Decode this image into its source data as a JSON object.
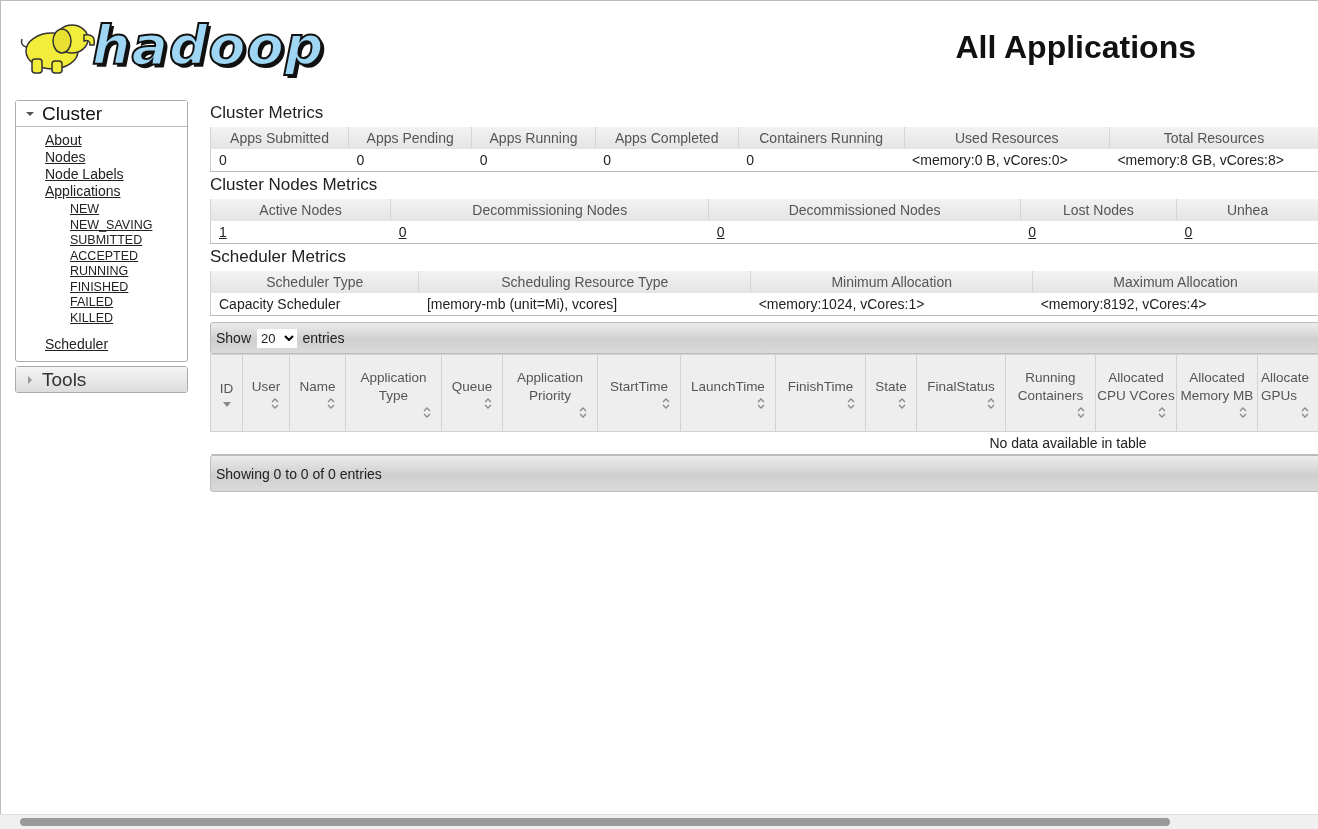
{
  "logo": {
    "text": "hadoop"
  },
  "title": "All Applications",
  "sidebar": [
    {
      "label": "Cluster",
      "expanded": true,
      "items": [
        {
          "label": "About"
        },
        {
          "label": "Nodes"
        },
        {
          "label": "Node Labels"
        },
        {
          "label": "Applications",
          "children": [
            {
              "label": "NEW"
            },
            {
              "label": "NEW_SAVING"
            },
            {
              "label": "SUBMITTED"
            },
            {
              "label": "ACCEPTED"
            },
            {
              "label": "RUNNING"
            },
            {
              "label": "FINISHED"
            },
            {
              "label": "FAILED"
            },
            {
              "label": "KILLED"
            }
          ]
        },
        {
          "label": "Scheduler"
        }
      ]
    },
    {
      "label": "Tools",
      "expanded": false
    }
  ],
  "metrics": [
    {
      "title": "Cluster Metrics",
      "columns": [
        "Apps Submitted",
        "Apps Pending",
        "Apps Running",
        "Apps Completed",
        "Containers Running",
        "Used Resources",
        "Total Resources"
      ],
      "cells": [
        {
          "text": "0",
          "link": false
        },
        {
          "text": "0",
          "link": false
        },
        {
          "text": "0",
          "link": false
        },
        {
          "text": "0",
          "link": false
        },
        {
          "text": "0",
          "link": false
        },
        {
          "text": "<memory:0 B, vCores:0>",
          "link": false
        },
        {
          "text": "<memory:8 GB, vCores:8>",
          "link": false
        }
      ]
    },
    {
      "title": "Cluster Nodes Metrics",
      "columns": [
        "Active Nodes",
        "Decommissioning Nodes",
        "Decommissioned Nodes",
        "Lost Nodes",
        "Unhea"
      ],
      "cells": [
        {
          "text": "1",
          "link": true
        },
        {
          "text": "0",
          "link": true
        },
        {
          "text": "0",
          "link": true
        },
        {
          "text": "0",
          "link": true
        },
        {
          "text": "0",
          "link": true
        }
      ]
    },
    {
      "title": "Scheduler Metrics",
      "columns": [
        "Scheduler Type",
        "Scheduling Resource Type",
        "Minimum Allocation",
        "Maximum Allocation"
      ],
      "cells": [
        {
          "text": "Capacity Scheduler",
          "link": false
        },
        {
          "text": "[memory-mb (unit=Mi), vcores]",
          "link": false
        },
        {
          "text": "<memory:1024, vCores:1>",
          "link": false
        },
        {
          "text": "<memory:8192, vCores:4>",
          "link": false
        }
      ]
    }
  ],
  "apps": {
    "show_label": "Show",
    "page_size": "20",
    "entries_label": "entries",
    "columns": [
      {
        "label": "ID",
        "sorted_descending": true
      },
      {
        "label": "User",
        "sorted_descending": false
      },
      {
        "label": "Name",
        "sorted_descending": false
      },
      {
        "label": "Application Type",
        "sorted_descending": false
      },
      {
        "label": "Queue",
        "sorted_descending": false
      },
      {
        "label": "Application Priority",
        "sorted_descending": false
      },
      {
        "label": "StartTime",
        "sorted_descending": false
      },
      {
        "label": "LaunchTime",
        "sorted_descending": false
      },
      {
        "label": "FinishTime",
        "sorted_descending": false
      },
      {
        "label": "State",
        "sorted_descending": false
      },
      {
        "label": "FinalStatus",
        "sorted_descending": false
      },
      {
        "label": "Running Containers",
        "sorted_descending": false
      },
      {
        "label": "Allocated CPU VCores",
        "sorted_descending": false
      },
      {
        "label": "Allocated Memory MB",
        "sorted_descending": false
      },
      {
        "label": "Allocate GPUs",
        "sorted_descending": false
      }
    ],
    "empty_text": "No data available in table",
    "info": "Showing 0 to 0 of 0 entries"
  }
}
